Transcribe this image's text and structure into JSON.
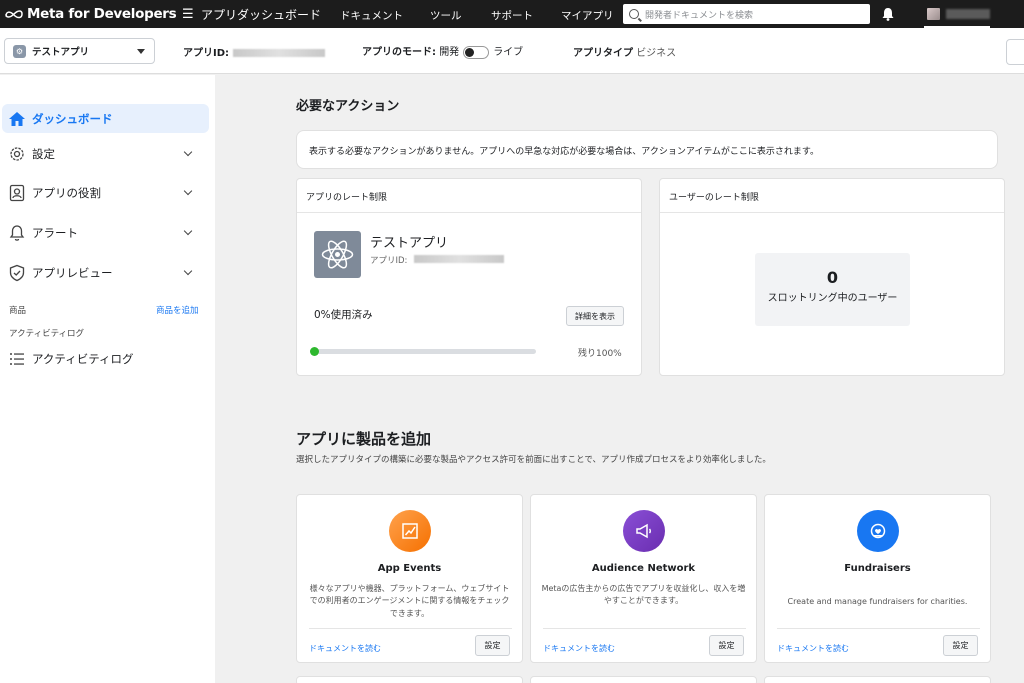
{
  "topnav": {
    "brand": "Meta for Developers",
    "title": "アプリダッシュボード",
    "links": [
      "ドキュメント",
      "ツール",
      "サポート",
      "マイアプリ"
    ],
    "search_placeholder": "開発者ドキュメントを検索"
  },
  "subbar": {
    "app_name": "テストアプリ",
    "app_id_label": "アプリID:",
    "mode_label": "アプリのモード:",
    "mode_dev": "開発",
    "mode_live": "ライブ",
    "type_label": "アプリタイプ",
    "type_value": "ビジネス"
  },
  "sidebar": {
    "items": [
      {
        "label": "ダッシュボード"
      },
      {
        "label": "設定"
      },
      {
        "label": "アプリの役割"
      },
      {
        "label": "アラート"
      },
      {
        "label": "アプリレビュー"
      }
    ],
    "products_label": "商品",
    "add_product_link": "商品を追加",
    "activity_small": "アクティビティログ",
    "activity_item": "アクティビティログ"
  },
  "main": {
    "required_title": "必要なアクション",
    "required_notice": "表示する必要なアクションがありません。アプリへの早急な対応が必要な場合は、アクションアイテムがここに表示されます。",
    "app_rate": {
      "header": "アプリのレート制限",
      "app_name": "テストアプリ",
      "app_id_label": "アプリID:",
      "usage_text": "0%使用済み",
      "details_button": "詳細を表示",
      "remaining_text": "残り100%",
      "usage_fraction": 0
    },
    "user_rate": {
      "header": "ユーザーのレート制限",
      "count": "0",
      "label": "スロットリング中のユーザー"
    },
    "add_products_title": "アプリに製品を追加",
    "add_products_desc": "選択したアプリタイプの構築に必要な製品やアクセス許可を前面に出すことで、アプリ作成プロセスをより効率化しました。",
    "products": [
      {
        "title": "App Events",
        "desc": "様々なアプリや機器、プラットフォーム、ウェブサイトでの利用者のエンゲージメントに関する情報をチェックできます。",
        "doc_link": "ドキュメントを読む",
        "button": "設定",
        "color": "#f7821b",
        "icon": "chart-icon"
      },
      {
        "title": "Audience Network",
        "desc": "Metaの広告主からの広告でアプリを収益化し、収入を増やすことができます。",
        "doc_link": "ドキュメントを読む",
        "button": "設定",
        "color": "#7b3fbf",
        "icon": "megaphone-icon"
      },
      {
        "title": "Fundraisers",
        "desc": "Create and manage fundraisers for charities.",
        "doc_link": "ドキュメントを読む",
        "button": "設定",
        "color": "#1877f2",
        "icon": "donation-icon"
      }
    ]
  }
}
